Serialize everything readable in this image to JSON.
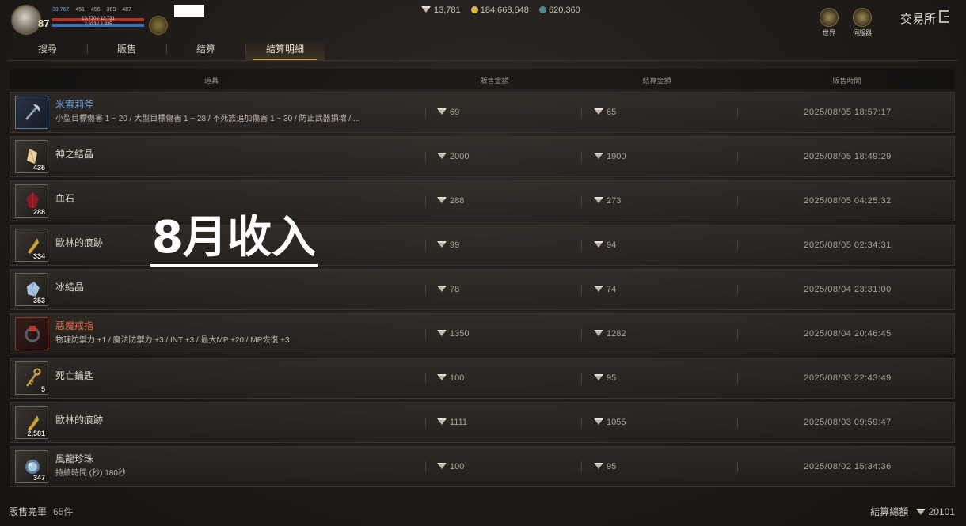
{
  "player": {
    "level": "87",
    "stats": [
      "33,767",
      "451",
      "456",
      "369",
      "487"
    ],
    "hp_text": "13,730 / 13,731",
    "mp_text": "2,933 / 2,935"
  },
  "currency": {
    "diamond": "13,781",
    "gold": "184,668,648",
    "other": "620,360"
  },
  "top_icons": {
    "world": "世界",
    "server": "伺服器"
  },
  "title": "交易所",
  "tabs": [
    "搜尋",
    "販售",
    "結算",
    "結算明細"
  ],
  "active_tab": 3,
  "columns": {
    "item": "道具",
    "sale": "販售金額",
    "settle": "結算金額",
    "time": "販售時間"
  },
  "rows": [
    {
      "name": "米索莉斧",
      "desc": "小型目標傷害 1 ~ 20 / 大型目標傷害 1 ~ 28 / 不死族追加傷害 1 ~ 30 / 防止武器損壞 / ...",
      "qty": "",
      "sale": "69",
      "settle": "65",
      "time": "2025/08/05 18:57:17",
      "name_color": "blue",
      "icon": "axe-icon"
    },
    {
      "name": "神之結晶",
      "desc": "",
      "qty": "435",
      "sale": "2000",
      "settle": "1900",
      "time": "2025/08/05 18:49:29",
      "name_color": "normal",
      "icon": "crystal-icon"
    },
    {
      "name": "血石",
      "desc": "",
      "qty": "288",
      "sale": "288",
      "settle": "273",
      "time": "2025/08/05 04:25:32",
      "name_color": "normal",
      "icon": "bloodstone-icon"
    },
    {
      "name": "歐林的痕跡",
      "desc": "",
      "qty": "334",
      "sale": "99",
      "settle": "94",
      "time": "2025/08/05 02:34:31",
      "name_color": "normal",
      "icon": "golden-trace-icon"
    },
    {
      "name": "冰結晶",
      "desc": "",
      "qty": "353",
      "sale": "78",
      "settle": "74",
      "time": "2025/08/04 23:31:00",
      "name_color": "normal",
      "icon": "ice-crystal-icon"
    },
    {
      "name": "惡魔戒指",
      "desc": "物理防禦力 +1 / 魔法防禦力 +3 / INT +3 / 最大MP +20 / MP恢復 +3",
      "qty": "",
      "sale": "1350",
      "settle": "1282",
      "time": "2025/08/04 20:46:45",
      "name_color": "red",
      "icon": "ring-icon"
    },
    {
      "name": "死亡鑰匙",
      "desc": "",
      "qty": "5",
      "sale": "100",
      "settle": "95",
      "time": "2025/08/03 22:43:49",
      "name_color": "normal",
      "icon": "key-icon"
    },
    {
      "name": "歐林的痕跡",
      "desc": "",
      "qty": "2,581",
      "sale": "1111",
      "settle": "1055",
      "time": "2025/08/03 09:59:47",
      "name_color": "normal",
      "icon": "golden-trace-icon"
    },
    {
      "name": "風龍珍珠",
      "desc": "持續時間 (秒) 180秒",
      "qty": "347",
      "sale": "100",
      "settle": "95",
      "time": "2025/08/02 15:34:36",
      "name_color": "normal",
      "icon": "pearl-icon"
    }
  ],
  "overlay_text": "8月收入",
  "footer": {
    "sold_label": "販售完畢",
    "sold_count": "65件",
    "total_label": "結算總額",
    "total_value": "20101"
  },
  "colors": {
    "accent": "#c9a964",
    "blue_name": "#6ea0e8",
    "red_name": "#e06a4a"
  }
}
